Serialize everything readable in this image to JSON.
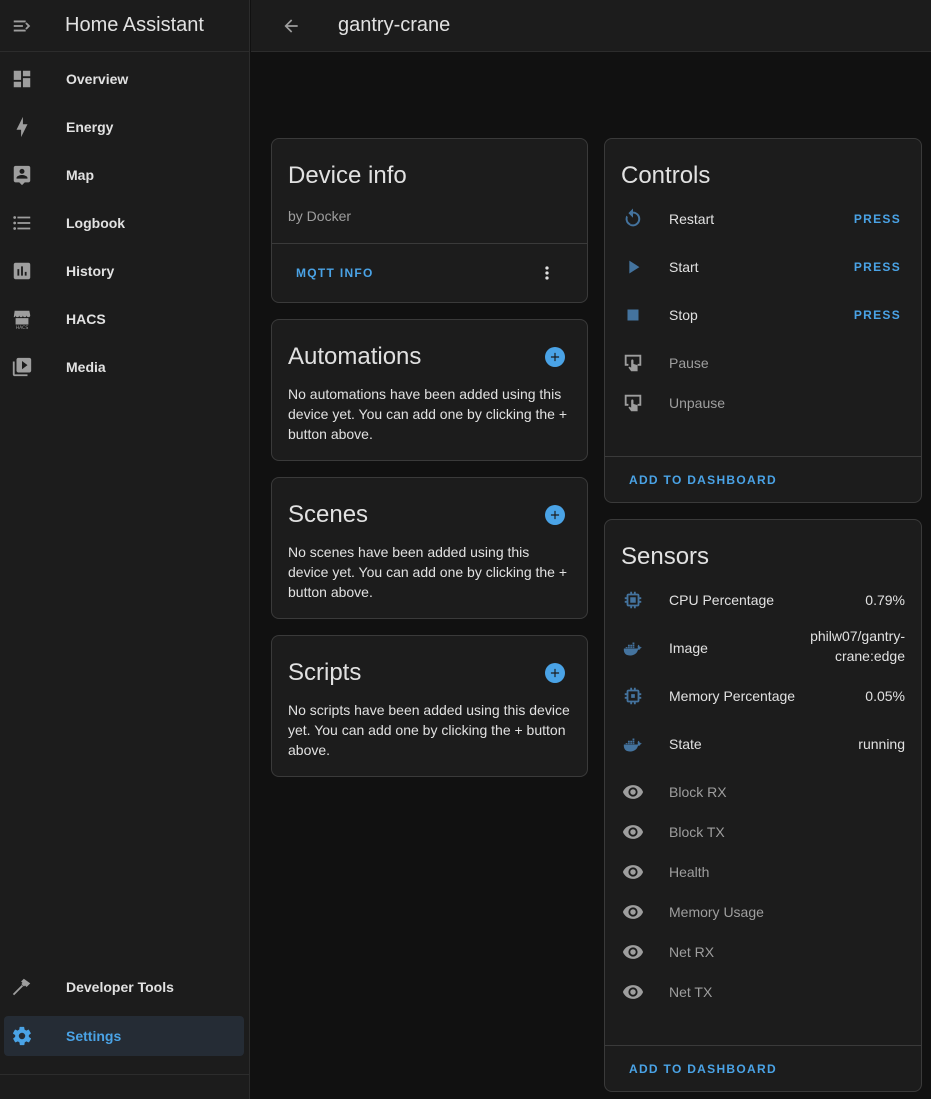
{
  "app": {
    "title": "Home Assistant"
  },
  "sidebar": {
    "items": [
      {
        "label": "Overview",
        "icon": "dashboard-icon"
      },
      {
        "label": "Energy",
        "icon": "lightning-icon"
      },
      {
        "label": "Map",
        "icon": "map-account-icon"
      },
      {
        "label": "Logbook",
        "icon": "list-icon"
      },
      {
        "label": "History",
        "icon": "chart-box-icon"
      },
      {
        "label": "HACS",
        "icon": "hacs-icon"
      },
      {
        "label": "Media",
        "icon": "media-icon"
      }
    ],
    "bottom": [
      {
        "label": "Developer Tools",
        "icon": "hammer-icon"
      },
      {
        "label": "Settings",
        "icon": "gear-icon",
        "active": true
      }
    ]
  },
  "header": {
    "title": "gantry-crane"
  },
  "device_info": {
    "title": "Device info",
    "manufacturer": "by Docker",
    "action": "MQTT INFO"
  },
  "automations": {
    "title": "Automations",
    "empty_text": "No automations have been added using this device yet. You can add one by clicking the + button above."
  },
  "scenes": {
    "title": "Scenes",
    "empty_text": "No scenes have been added using this device yet. You can add one by clicking the + button above."
  },
  "scripts": {
    "title": "Scripts",
    "empty_text": "No scripts have been added using this device yet. You can add one by clicking the + button above."
  },
  "controls": {
    "title": "Controls",
    "items": [
      {
        "name": "Restart",
        "action": "PRESS",
        "icon": "restart-icon"
      },
      {
        "name": "Start",
        "action": "PRESS",
        "icon": "play-icon"
      },
      {
        "name": "Stop",
        "action": "PRESS",
        "icon": "stop-icon"
      },
      {
        "name": "Pause",
        "icon": "gesture-tap-icon",
        "disabled": true
      },
      {
        "name": "Unpause",
        "icon": "gesture-tap-icon",
        "disabled": true
      }
    ],
    "add_to_dashboard": "ADD TO DASHBOARD"
  },
  "sensors": {
    "title": "Sensors",
    "items": [
      {
        "name": "CPU Percentage",
        "value": "0.79%",
        "icon": "chip-icon"
      },
      {
        "name": "Image",
        "value_line1": "philw07/gantry-",
        "value_line2": "crane:edge",
        "icon": "docker-icon"
      },
      {
        "name": "Memory Percentage",
        "value": "0.05%",
        "icon": "memory-chip-icon"
      },
      {
        "name": "State",
        "value": "running",
        "icon": "docker-icon"
      },
      {
        "name": "Block RX",
        "icon": "eye-icon",
        "disabled": true
      },
      {
        "name": "Block TX",
        "icon": "eye-icon",
        "disabled": true
      },
      {
        "name": "Health",
        "icon": "eye-icon",
        "disabled": true
      },
      {
        "name": "Memory Usage",
        "icon": "eye-icon",
        "disabled": true
      },
      {
        "name": "Net RX",
        "icon": "eye-icon",
        "disabled": true
      },
      {
        "name": "Net TX",
        "icon": "eye-icon",
        "disabled": true
      }
    ],
    "add_to_dashboard": "ADD TO DASHBOARD"
  },
  "colors": {
    "accent": "#4aa3e6",
    "icon_blue": "#44739e",
    "background": "#111111",
    "card": "#1c1c1c"
  }
}
